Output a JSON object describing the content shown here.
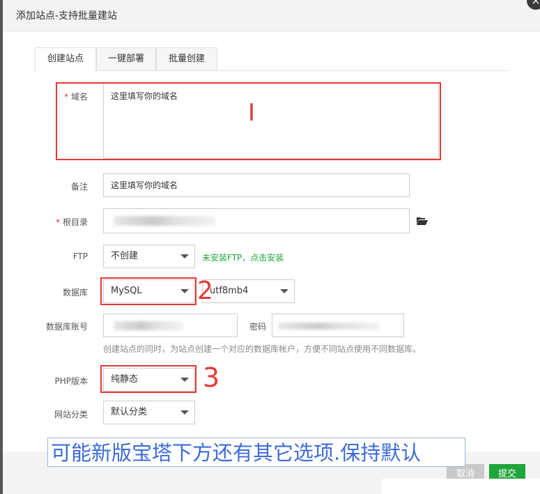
{
  "dialog": {
    "title": "添加站点-支持批量建站",
    "close_glyph": "×"
  },
  "tabs": [
    {
      "label": "创建站点",
      "active": true
    },
    {
      "label": "一键部署",
      "active": false
    },
    {
      "label": "批量创建",
      "active": false
    }
  ],
  "form": {
    "domain_label": "域名",
    "domain_value": "这里填写你的域名",
    "remark_label": "备注",
    "remark_value": "这里填写你的域名",
    "root_label": "根目录",
    "folder_icon": "folder-open-icon",
    "ftp_label": "FTP",
    "ftp_value": "不创建",
    "ftp_hint": "未安装FTP，点击安装",
    "db_label": "数据库",
    "db_type": "MySQL",
    "db_charset": "utf8mb4",
    "db_account_label": "数据库账号",
    "db_password_label": "密码",
    "db_hint": "创建站点的同时，为站点创建一个对应的数据库帐户，方便不同站点使用不同数据库。",
    "php_label": "PHP版本",
    "php_value": "纯静态",
    "category_label": "网站分类",
    "category_value": "默认分类",
    "required_mark": "*"
  },
  "annotations": {
    "n1": "I",
    "n2": "2",
    "n3": "3",
    "overlay": "可能新版宝塔下方还有其它选项.保持默认"
  },
  "footer": {
    "cancel_label": "取消",
    "submit_label": "提交"
  },
  "colors": {
    "accent_green": "#20a53a",
    "annotation_red": "#e53935",
    "overlay_blue": "#3d6bd8"
  }
}
